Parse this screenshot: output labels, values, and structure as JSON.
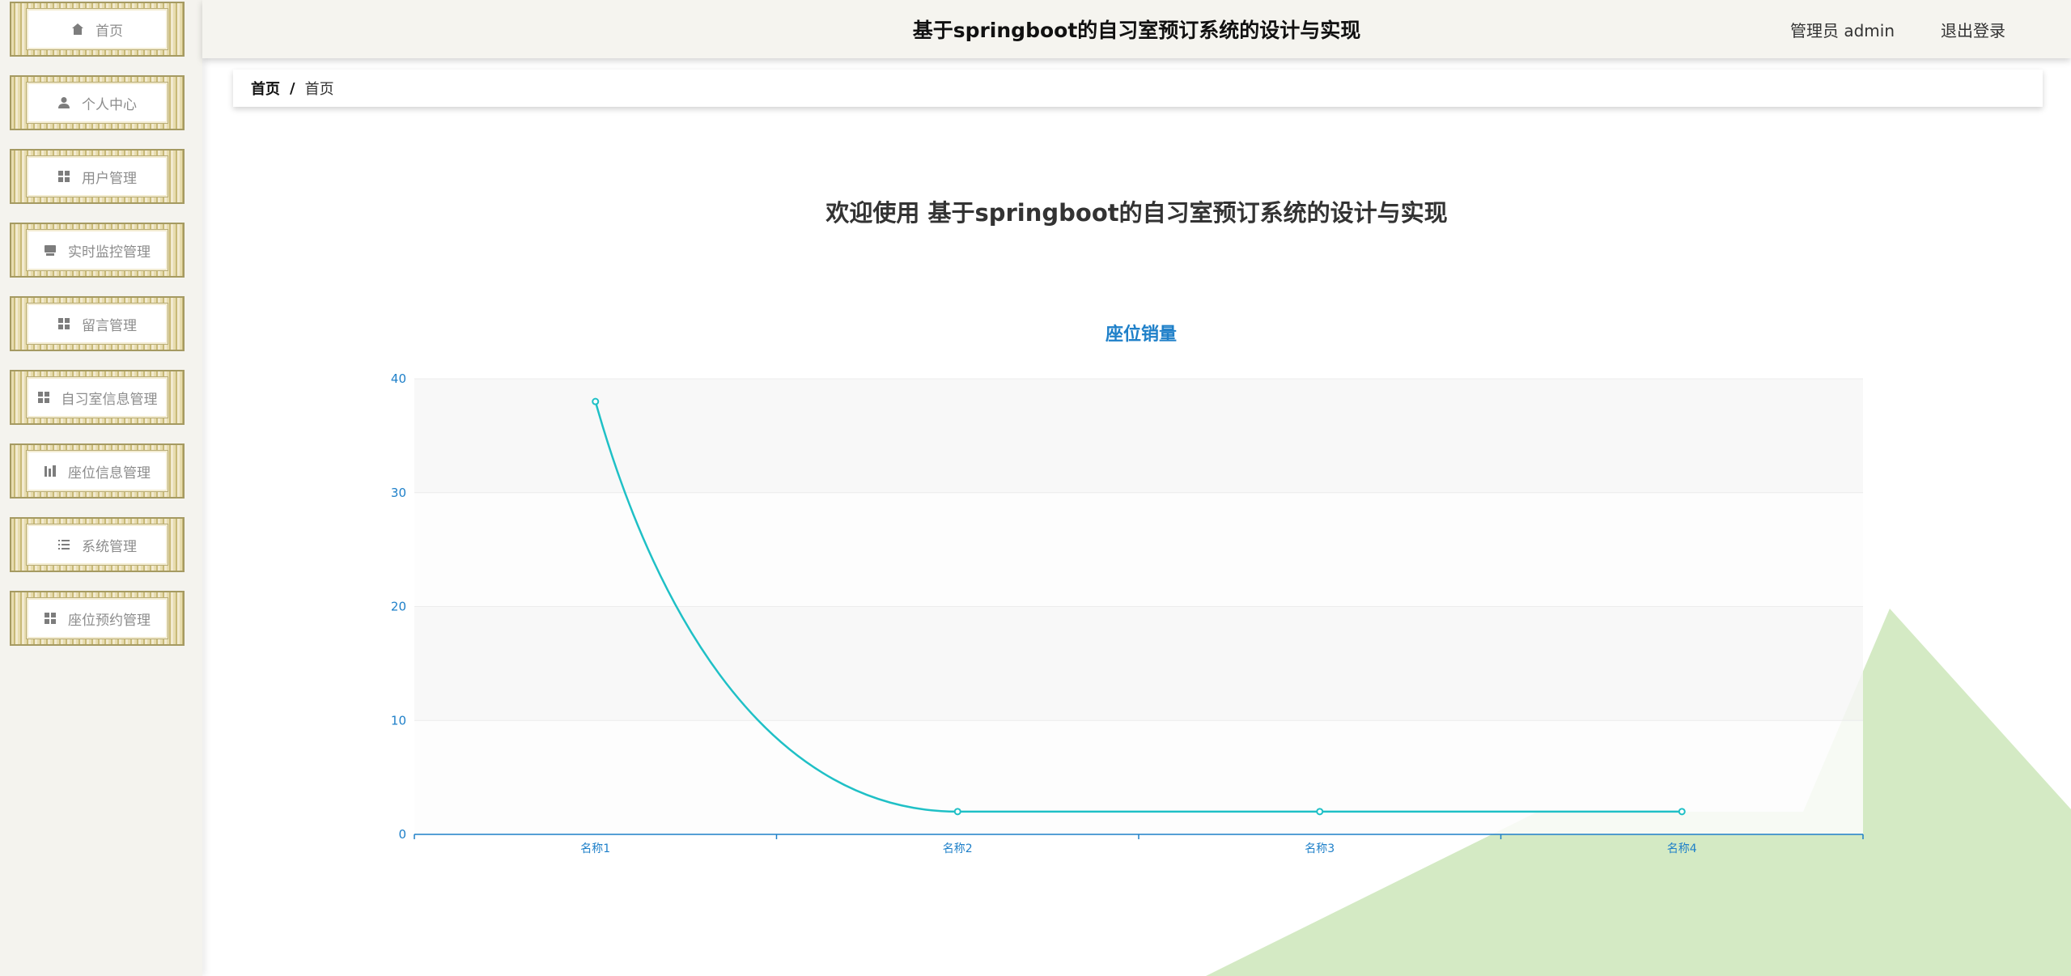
{
  "header": {
    "app_title": "基于springboot的自习室预订系统的设计与实现",
    "admin_label": "管理员 admin",
    "logout_label": "退出登录"
  },
  "sidebar": {
    "items": [
      {
        "label": "首页",
        "icon": "home-icon"
      },
      {
        "label": "个人中心",
        "icon": "user-icon"
      },
      {
        "label": "用户管理",
        "icon": "grid-icon"
      },
      {
        "label": "实时监控管理",
        "icon": "monitor-icon"
      },
      {
        "label": "留言管理",
        "icon": "grid-icon"
      },
      {
        "label": "自习室信息管理",
        "icon": "grid-icon"
      },
      {
        "label": "座位信息管理",
        "icon": "chart-icon"
      },
      {
        "label": "系统管理",
        "icon": "list-icon"
      },
      {
        "label": "座位预约管理",
        "icon": "grid-icon"
      }
    ]
  },
  "breadcrumb": {
    "root": "首页",
    "separator": "/",
    "current": "首页"
  },
  "welcome_text": "欢迎使用 基于springboot的自习室预订系统的设计与实现",
  "chart_data": {
    "type": "line",
    "title": "座位销量",
    "categories": [
      "名称1",
      "名称2",
      "名称3",
      "名称4"
    ],
    "series": [
      {
        "values": [
          38,
          2,
          2,
          2
        ]
      }
    ],
    "ylim": [
      0,
      40
    ],
    "yticks": [
      0,
      10,
      20,
      30,
      40
    ],
    "grid": true,
    "smooth": true,
    "line_color": "#1fc0c6",
    "axis_color": "#1f80c9"
  },
  "colors": {
    "deco_green": "#d4eac4",
    "menu_border": "#a59a62"
  }
}
